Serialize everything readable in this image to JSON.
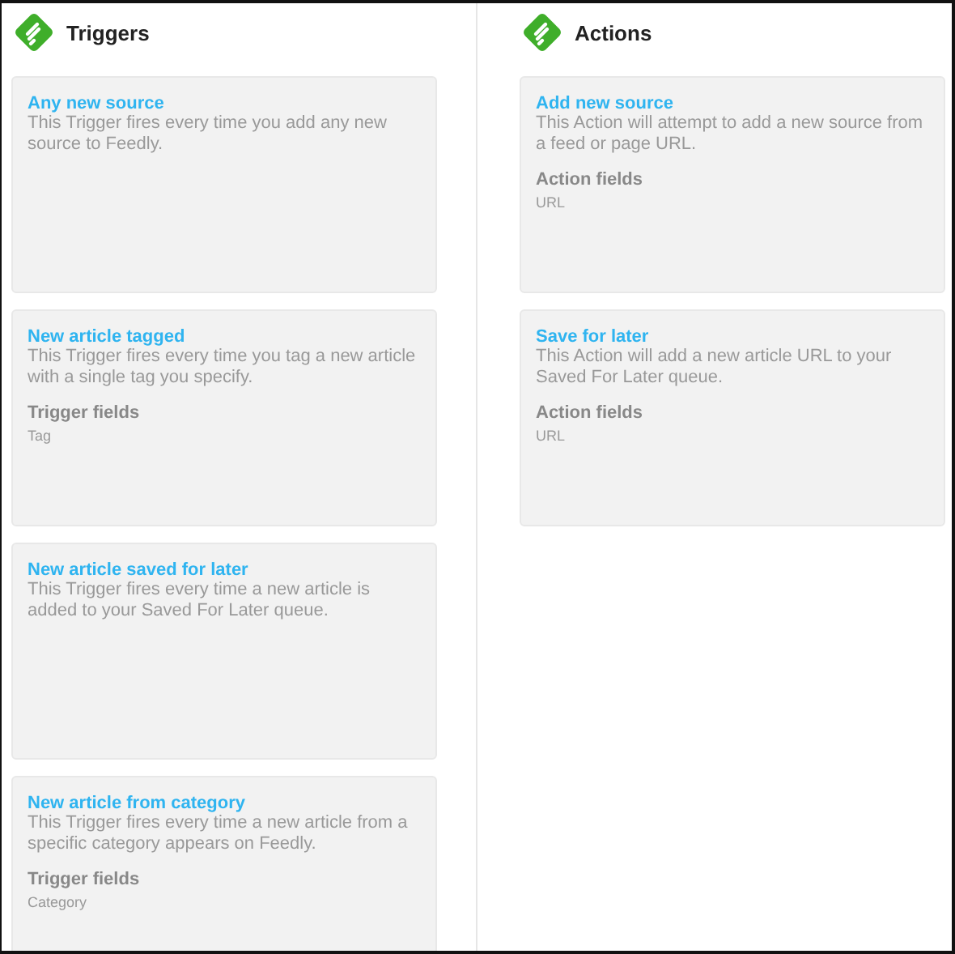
{
  "columns": [
    {
      "title": "Triggers",
      "cards": [
        {
          "title": "Any new source",
          "description": "This Trigger fires every time you add any new source to Feedly."
        },
        {
          "title": "New article tagged",
          "description": "This Trigger fires every time you tag a new article with a single tag you specify.",
          "fields_label": "Trigger fields",
          "fields": "Tag"
        },
        {
          "title": "New article saved for later",
          "description": "This Trigger fires every time a new article is added to your Saved For Later queue."
        },
        {
          "title": "New article from category",
          "description": "This Trigger fires every time a new article from a specific category appears on Feedly.",
          "fields_label": "Trigger fields",
          "fields": "Category"
        }
      ]
    },
    {
      "title": "Actions",
      "cards": [
        {
          "title": "Add new source",
          "description": "This Action will attempt to add a new source from a feed or page URL.",
          "fields_label": "Action fields",
          "fields": "URL"
        },
        {
          "title": "Save for later",
          "description": "This Action will add a new article URL to your Saved For Later queue.",
          "fields_label": "Action fields",
          "fields": "URL"
        }
      ]
    }
  ]
}
